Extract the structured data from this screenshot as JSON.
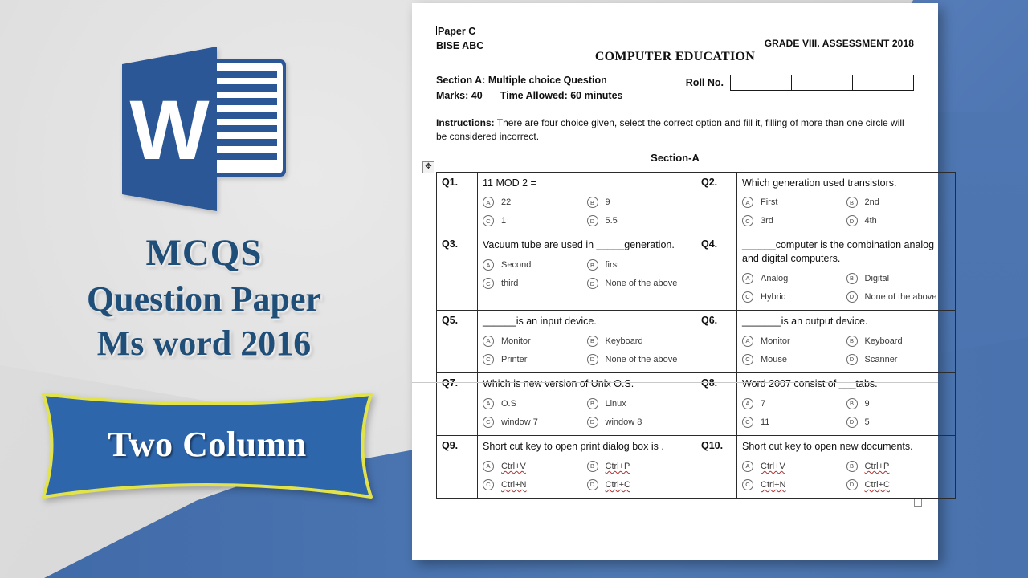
{
  "branding": {
    "logo_name": "ms-word-logo",
    "logo_letter": "W",
    "title_line1": "MCQS",
    "title_line2": "Question Paper",
    "title_line3": "Ms word 2016",
    "ribbon_label": "Two Column",
    "colors": {
      "brand_blue": "#2b579a",
      "logo_blue": "#2b5797",
      "title_blue": "#1f4e79",
      "ribbon_fill": "#2e66ac",
      "ribbon_outline": "#e2e34a",
      "background_gray": "#dcdcdc",
      "background_blue": "#4a72ad"
    }
  },
  "document": {
    "header": {
      "paper": "Paper C",
      "board": "BISE ABC",
      "grade_line": "GRADE VIII. ASSESSMENT 2018",
      "subject": "COMPUTER EDUCATION",
      "section_label": "Section A: Multiple choice Question",
      "marks": "Marks: 40",
      "time_allowed": "Time Allowed: 60 minutes",
      "roll_no_label": "Roll No.",
      "roll_no_cells": 6,
      "instructions_label": "Instructions:",
      "instructions_text": " There are four choice given, select the correct option and fill it, filling of more than one circle will be considered incorrect.",
      "section_heading": "Section-A"
    },
    "table": {
      "move_handle_icon": "move-cross-icon",
      "resize_handle_icon": "resize-handle-icon",
      "option_bubbles": [
        "A",
        "B",
        "C",
        "D"
      ],
      "rows": [
        {
          "left": {
            "num": "Q1.",
            "text": "11 MOD 2 =",
            "options": [
              "22",
              "9",
              "1",
              "5.5"
            ]
          },
          "right": {
            "num": "Q2.",
            "text": "Which generation used transistors.",
            "options": [
              "First",
              "2nd",
              "3rd",
              "4th"
            ]
          }
        },
        {
          "left": {
            "num": "Q3.",
            "text": "Vacuum tube are used in _____generation.",
            "options": [
              "Second",
              "first",
              "third",
              "None of the above"
            ]
          },
          "right": {
            "num": "Q4.",
            "text": "______computer is the combination analog and digital computers.",
            "options": [
              "Analog",
              "Digital",
              "Hybrid",
              "None of the above"
            ]
          }
        },
        {
          "left": {
            "num": "Q5.",
            "text": "______is an input device.",
            "options": [
              "Monitor",
              "Keyboard",
              "Printer",
              "None of the above"
            ]
          },
          "right": {
            "num": "Q6.",
            "text": "_______is an output device.",
            "options": [
              "Monitor",
              "Keyboard",
              "Mouse",
              "Scanner"
            ]
          },
          "split": true
        },
        {
          "left": {
            "num": "Q7.",
            "text": "Which is new version of Unix O.S.",
            "options": [
              "O.S",
              "Linux",
              "window 7",
              "window 8"
            ]
          },
          "right": {
            "num": "Q8.",
            "text": "Word 2007 consist of ___tabs.",
            "options": [
              "7",
              "9",
              "11",
              "5"
            ]
          }
        },
        {
          "left": {
            "num": "Q9.",
            "text": "Short cut key to open print dialog box is .",
            "options": [
              "Ctrl+V",
              "Ctrl+P",
              "Ctrl+N",
              "Ctrl+C"
            ],
            "spellcheck_options": true
          },
          "right": {
            "num": "Q10.",
            "text": "Short cut key to open new documents.",
            "options": [
              "Ctrl+V",
              "Ctrl+P",
              "Ctrl+N",
              "Ctrl+C"
            ],
            "spellcheck_options": true
          }
        }
      ]
    }
  }
}
